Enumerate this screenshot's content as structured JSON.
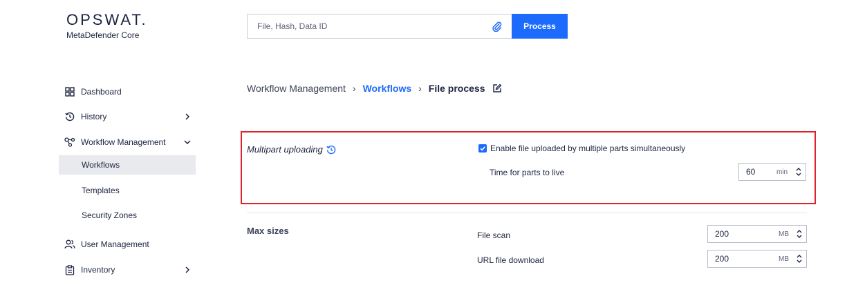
{
  "brand": {
    "name": "OPSWAT.",
    "product": "MetaDefender Core"
  },
  "search": {
    "placeholder": "File, Hash, Data ID",
    "value": "",
    "process_label": "Process"
  },
  "sidebar": {
    "items": [
      {
        "label": "Dashboard",
        "icon": "grid-icon"
      },
      {
        "label": "History",
        "icon": "history-icon",
        "chevron": "right"
      },
      {
        "label": "Workflow Management",
        "icon": "workflow-icon",
        "chevron": "down"
      },
      {
        "label": "User Management",
        "icon": "users-icon"
      },
      {
        "label": "Inventory",
        "icon": "clipboard-icon",
        "chevron": "right"
      }
    ],
    "subitems": [
      {
        "label": "Workflows",
        "active": true
      },
      {
        "label": "Templates",
        "active": false
      },
      {
        "label": "Security Zones",
        "active": false
      }
    ]
  },
  "breadcrumb": {
    "root": "Workflow Management",
    "link": "Workflows",
    "current": "File process"
  },
  "multipart": {
    "title": "Multipart uploading",
    "checkbox_label": "Enable file uploaded by multiple parts simultaneously",
    "checked": true,
    "ttl_label": "Time for parts to live",
    "ttl_value": "60",
    "ttl_unit": "min"
  },
  "max_sizes": {
    "title": "Max sizes",
    "file_scan_label": "File scan",
    "file_scan_value": "200",
    "file_scan_unit": "MB",
    "url_label": "URL file download",
    "url_value": "200",
    "url_unit": "MB"
  },
  "colors": {
    "accent": "#1d6bfc",
    "highlight": "#e0202a",
    "text": "#1d2340"
  }
}
